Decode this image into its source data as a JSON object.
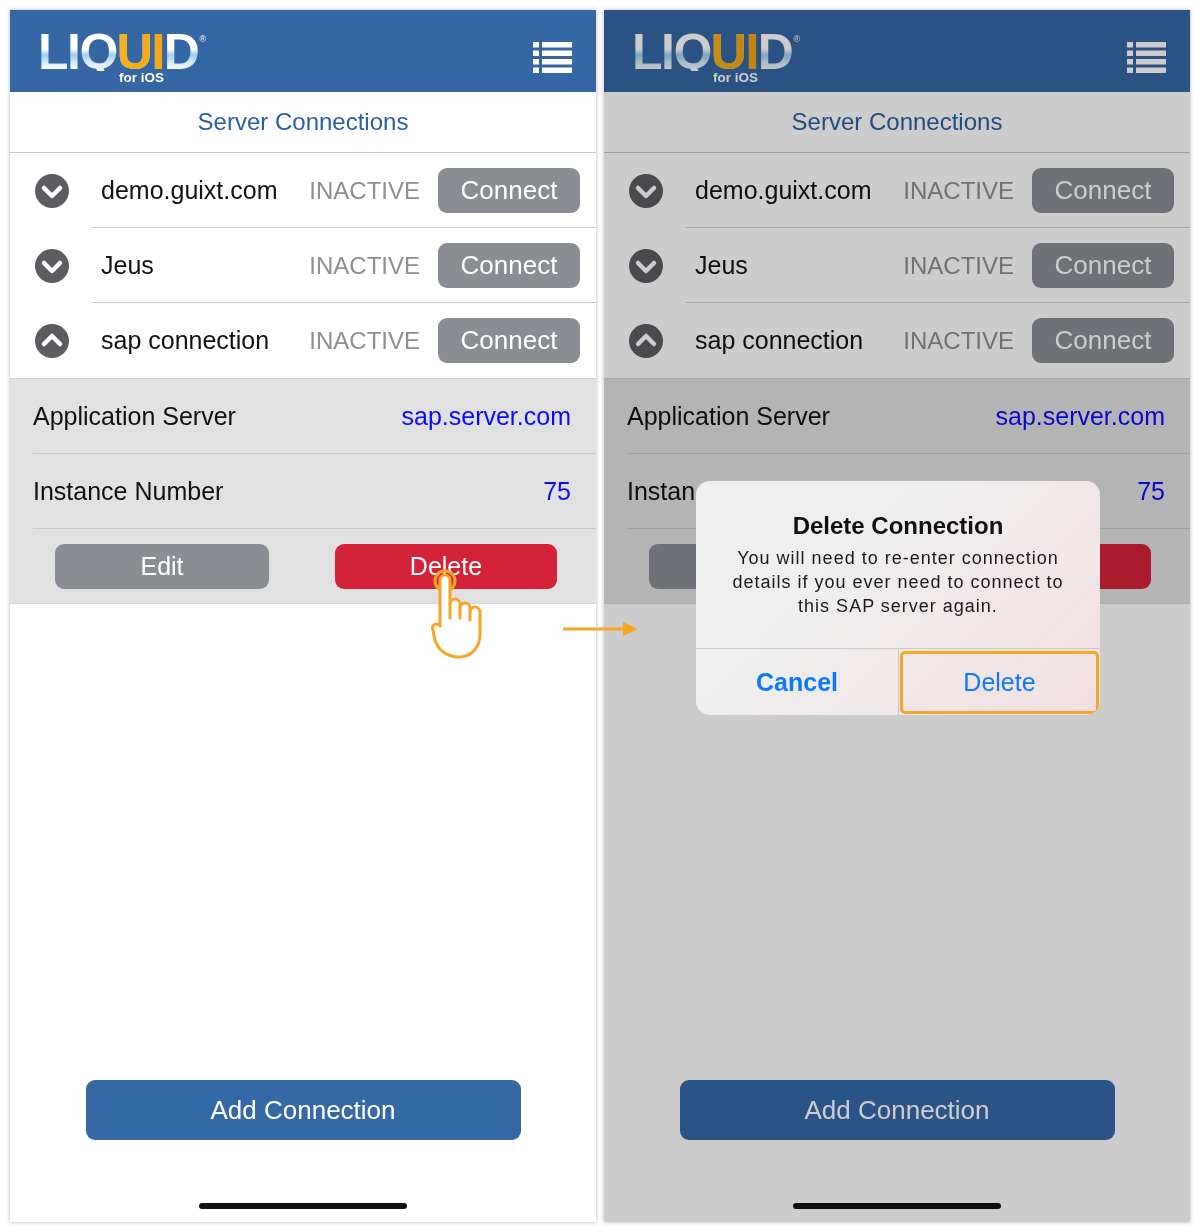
{
  "screens": [
    {
      "dimmed": false,
      "header": {
        "logo": {
          "wordmark": "LIQUID",
          "registered": "®",
          "subtitle": "for iOS"
        }
      },
      "title": "Server Connections",
      "connections": [
        {
          "name": "demo.guixt.com",
          "status": "INACTIVE",
          "action": "Connect",
          "expanded": false
        },
        {
          "name": "Jeus",
          "status": "INACTIVE",
          "action": "Connect",
          "expanded": false
        },
        {
          "name": "sap connection",
          "status": "INACTIVE",
          "action": "Connect",
          "expanded": true,
          "details": [
            {
              "label": "Application Server",
              "value": "sap.server.com"
            },
            {
              "label": "Instance Number",
              "value": "75"
            }
          ],
          "actions": [
            {
              "kind": "edit",
              "label": "Edit",
              "tapped": false
            },
            {
              "kind": "delete",
              "label": "Delete",
              "tapped": true
            }
          ]
        }
      ],
      "add_button": "Add Connection"
    },
    {
      "dimmed": true,
      "header": {
        "logo": {
          "wordmark": "LIQUID",
          "registered": "®",
          "subtitle": "for iOS"
        }
      },
      "title": "Server Connections",
      "connections": [
        {
          "name": "demo.guixt.com",
          "status": "INACTIVE",
          "action": "Connect",
          "expanded": false
        },
        {
          "name": "Jeus",
          "status": "INACTIVE",
          "action": "Connect",
          "expanded": false
        },
        {
          "name": "sap connection",
          "status": "INACTIVE",
          "action": "Connect",
          "expanded": true,
          "details": [
            {
              "label": "Application Server",
              "value": "sap.server.com"
            },
            {
              "label": "Instan",
              "value": "75"
            }
          ],
          "actions": [
            {
              "kind": "edit"
            },
            {
              "kind": "delete"
            }
          ]
        }
      ],
      "add_button": "Add Connection",
      "dialog": {
        "title": "Delete Connection",
        "message": "You will need to re-enter connection details if you ever need to connect to this SAP server again.",
        "buttons": [
          {
            "label": "Cancel",
            "kind": "cancel",
            "highlighted": false
          },
          {
            "label": "Delete",
            "kind": "default",
            "highlighted": true
          }
        ]
      }
    }
  ]
}
